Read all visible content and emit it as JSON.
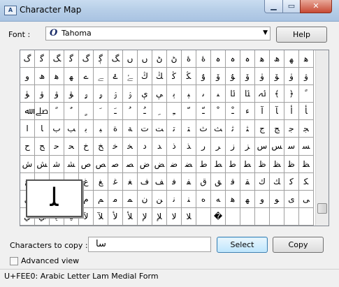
{
  "window": {
    "title": "Character Map",
    "icon_text": "A"
  },
  "font": {
    "label": "Font :",
    "selected": "Tahoma",
    "icon_glyph": "O"
  },
  "buttons": {
    "help": "Help",
    "select": "Select",
    "copy": "Copy"
  },
  "grid": {
    "rows": [
      [
        "ﮒ",
        "ﮔ",
        "ﮓ",
        "ﮔ",
        "گ",
        "ﮘ",
        "ﮓ",
        "ں",
        "ں",
        "ڻ",
        "ڻ",
        "ۀ",
        "ۀ",
        "ہ",
        "ہ",
        "ہ",
        "ﻫ",
        "ھ",
        "ﮭ",
        "ﮬ"
      ],
      [
        "ﻭ",
        "ﮪ",
        "ﮬ",
        "ﮭ",
        "ے",
        "ﮯ",
        "ۓ",
        "ﮱ",
        "ﯓ",
        "ﯔ",
        "ﯕ",
        "ﯖ",
        "ﯗ",
        "ۆ",
        "ﯘ",
        "ﯙ",
        "ۈ",
        "ﯚ",
        "ﯛ",
        "ۋ"
      ],
      [
        "ﯜ",
        "ۋ",
        "ﯞ",
        "ﯟ",
        "ﯠ",
        "ﯡ",
        "ﯢ",
        "ﯣ",
        "ﯤ",
        "ﯥ",
        "ﯦ",
        "ﯧ",
        "ﯨ",
        "ﯩ",
        "ﯪ",
        "ﯫ",
        "ﯬ",
        "﴾",
        "﴿",
        "ﹰ"
      ],
      [
        "ﷲ",
        "ﷰ",
        "ﹰ",
        "ﹲ",
        "ﹴ",
        "ﹶ",
        "ﹷ",
        "ﹸ",
        "ﹹ",
        "ﹺ",
        "ﹻ",
        "ﹼ",
        "ﹽ",
        "ﹾ",
        "ﹿ",
        "ﺀ",
        "ﺁ",
        "ﺂ",
        "ﺃ",
        "ﺄ"
      ],
      [
        "ﺍ",
        "ﺎ",
        "ﺏ",
        "ﺐ",
        "ﺑ",
        "ﺒ",
        "ﺓ",
        "ﺔ",
        "ﺕ",
        "ﺖ",
        "ﺗ",
        "ﺘ",
        "ﺙ",
        "ﺚ",
        "ﺛ",
        "ﺜ",
        "ﺝ",
        "ﺞ",
        "ﺟ",
        "ﺠ"
      ],
      [
        "ﺡ",
        "ﺢ",
        "ﺣ",
        "ﺤ",
        "ﺥ",
        "ﺦ",
        "ﺧ",
        "ﺨ",
        "ﺩ",
        "ﺪ",
        "ﺫ",
        "ﺬ",
        "ﺭ",
        "ﺮ",
        "ﺯ",
        "ﺰ",
        "ﺱ",
        "ﺲ",
        "ﺳ",
        "ﺴ"
      ],
      [
        "ﺵ",
        "ﺶ",
        "ﺷ",
        "ﺸ",
        "ﺹ",
        "ﺺ",
        "ﺻ",
        "ﺼ",
        "ﺽ",
        "ﺾ",
        "ﺿ",
        "ﻀ",
        "ﻁ",
        "ﻂ",
        "ﻃ",
        "ﻄ",
        "ﻅ",
        "ﻆ",
        "ﻇ",
        "ﻈ"
      ],
      [
        "ﻉ",
        "ﻊ",
        "ﻋ",
        "ﻌ",
        "ﻍ",
        "ﻎ",
        "ﻏ",
        "ﻐ",
        "ﻑ",
        "ﻒ",
        "ﻓ",
        "ﻔ",
        "ﻕ",
        "ﻖ",
        "ﻗ",
        "ﻘ",
        "ﻙ",
        "ﻚ",
        "ﻛ",
        "ﻜ"
      ],
      [
        "ﻝ",
        "ﻞ",
        "ﻟ",
        "ﻠ",
        "ﻡ",
        "ﻢ",
        "ﻣ",
        "ﻤ",
        "ﻥ",
        "ﻦ",
        "ﻧ",
        "ﻨ",
        "ﻩ",
        "ﻪ",
        "ﻫ",
        "ﻬ",
        "ﻭ",
        "ﻮ",
        "ﻯ",
        "ﻰ"
      ],
      [
        "ﻱ",
        "ﻲ",
        "ﻳ",
        "ﻴ",
        "ﻵ",
        "ﻶ",
        "ﻷ",
        "ﻸ",
        "ﻹ",
        "ﻺ",
        "ﻻ",
        "ﻼ",
        "﻿",
        "�",
        "",
        "",
        "",
        "",
        "",
        ""
      ]
    ]
  },
  "zoom": {
    "glyph": "ﻠ"
  },
  "copy": {
    "label": "Characters to copy :",
    "value": "سا"
  },
  "advanced": {
    "label": "Advanced view",
    "checked": false
  },
  "status": {
    "text": "U+FEE0: Arabic Letter Lam Medial Form"
  }
}
